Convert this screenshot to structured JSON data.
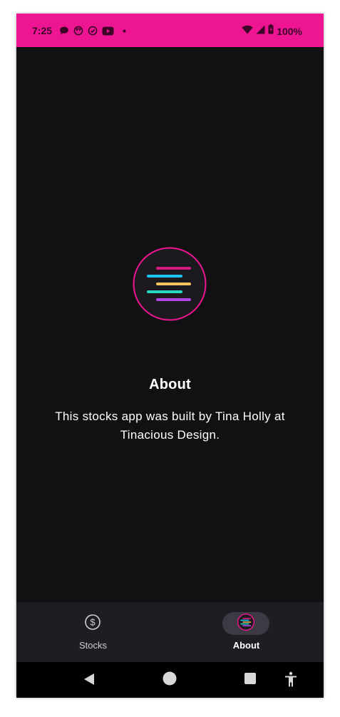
{
  "status_bar": {
    "time": "7:25",
    "battery": "100%",
    "icons": [
      "chat-bubble-icon",
      "face-icon",
      "check-circle-icon",
      "youtube-icon",
      "dot-icon",
      "wifi-icon",
      "signal-icon",
      "battery-icon"
    ]
  },
  "about": {
    "title": "About",
    "description": "This stocks app was built by Tina Holly at Tinacious Design."
  },
  "bottom_nav": {
    "items": [
      {
        "label": "Stocks",
        "icon": "dollar-circle-icon",
        "selected": false
      },
      {
        "label": "About",
        "icon": "app-logo-icon",
        "selected": true
      }
    ]
  },
  "system_nav": [
    "back-icon",
    "home-icon",
    "recents-icon",
    "accessibility-icon"
  ],
  "colors": {
    "accent": "#ee1592",
    "background": "#111113",
    "nav_background": "#1f1d23",
    "logo_lines": [
      "#d61a80",
      "#1ec4f0",
      "#f7c35b",
      "#28d8c0",
      "#b046e8"
    ]
  }
}
